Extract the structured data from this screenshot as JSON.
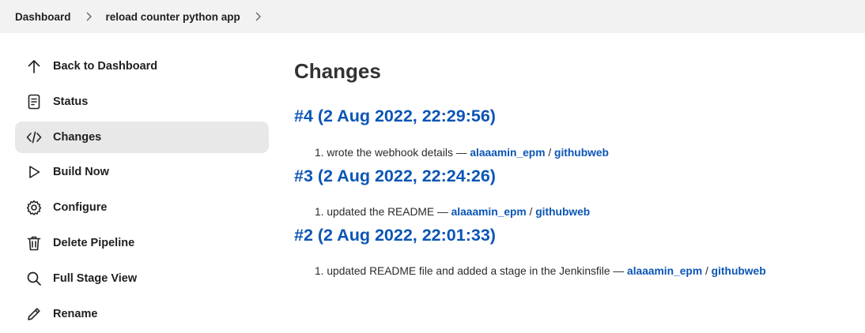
{
  "breadcrumb": {
    "items": [
      "Dashboard",
      "reload counter python app"
    ]
  },
  "sidebar": {
    "items": [
      {
        "label": "Back to Dashboard",
        "icon": "arrow-up-icon",
        "active": false
      },
      {
        "label": "Status",
        "icon": "document-icon",
        "active": false
      },
      {
        "label": "Changes",
        "icon": "code-icon",
        "active": true
      },
      {
        "label": "Build Now",
        "icon": "play-icon",
        "active": false
      },
      {
        "label": "Configure",
        "icon": "gear-icon",
        "active": false
      },
      {
        "label": "Delete Pipeline",
        "icon": "trash-icon",
        "active": false
      },
      {
        "label": "Full Stage View",
        "icon": "search-icon",
        "active": false
      },
      {
        "label": "Rename",
        "icon": "pencil-icon",
        "active": false
      }
    ]
  },
  "main": {
    "title": "Changes",
    "builds": [
      {
        "heading": "#4 (2 Aug 2022, 22:29:56)",
        "changes": [
          {
            "number": "1.",
            "message": "wrote the webhook details —",
            "author": "alaaamin_epm",
            "separator": "/",
            "link": "githubweb"
          }
        ]
      },
      {
        "heading": "#3 (2 Aug 2022, 22:24:26)",
        "changes": [
          {
            "number": "1.",
            "message": "updated the README —",
            "author": "alaaamin_epm",
            "separator": "/",
            "link": "githubweb"
          }
        ]
      },
      {
        "heading": "#2 (2 Aug 2022, 22:01:33)",
        "changes": [
          {
            "number": "1.",
            "message": "updated README file and added a stage in the Jenkinsfile —",
            "author": "alaaamin_epm",
            "separator": "/",
            "link": "githubweb"
          }
        ]
      }
    ]
  },
  "colors": {
    "link": "#0b55b5",
    "active_bg": "#e8e8e8",
    "breadcrumb_bg": "#f2f2f2"
  }
}
